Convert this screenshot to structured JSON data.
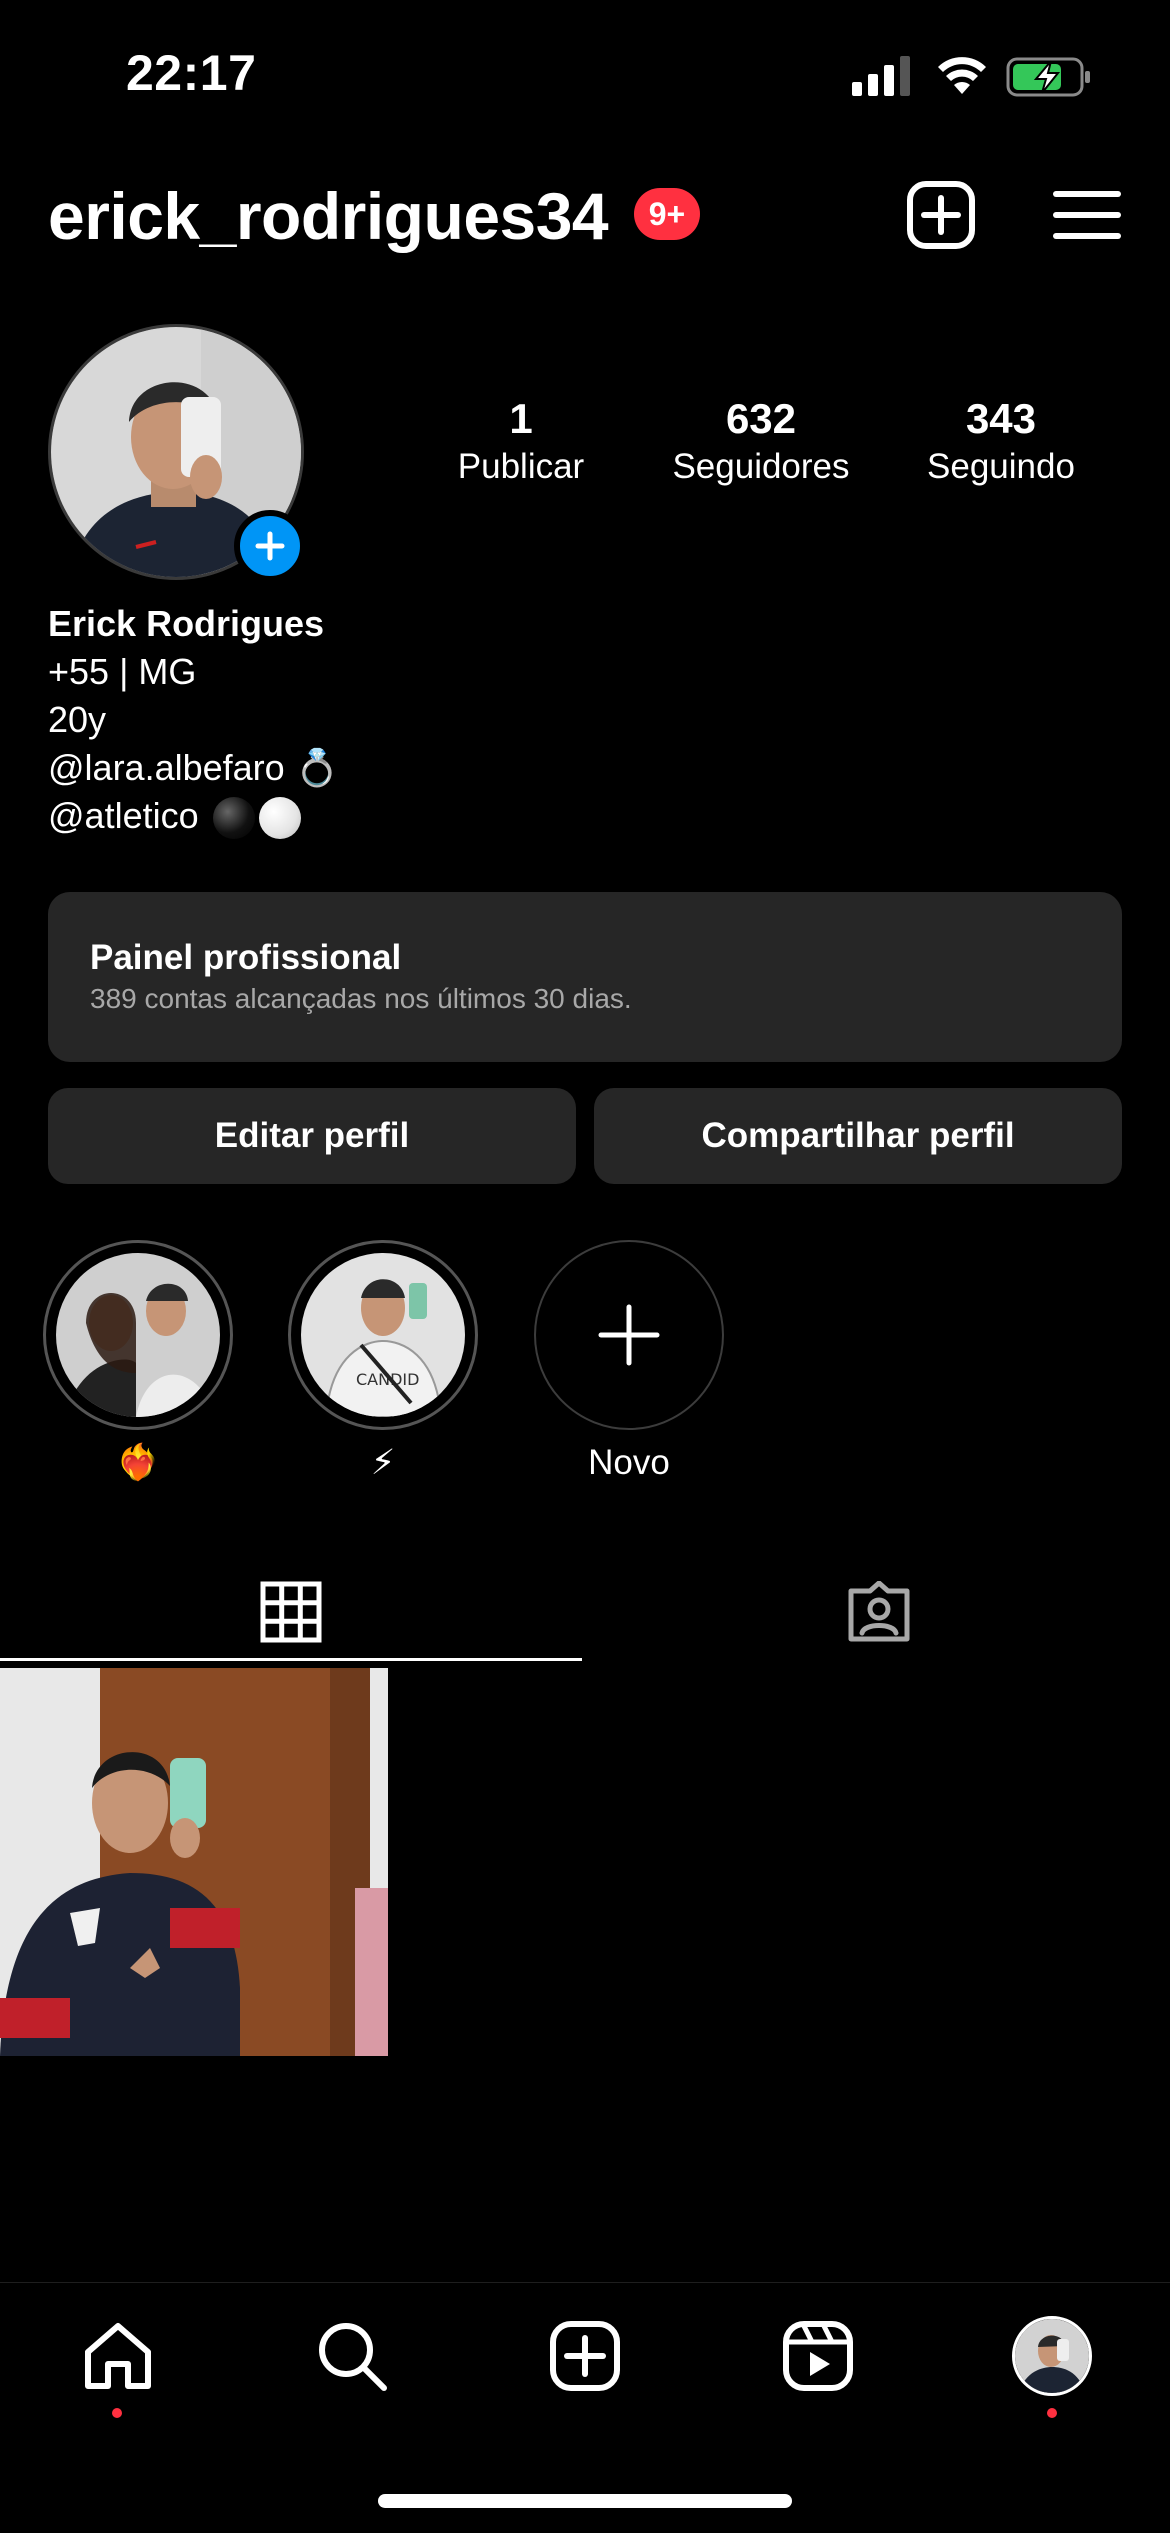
{
  "status_bar": {
    "time": "22:17"
  },
  "header": {
    "username": "erick_rodrigues34",
    "notification_badge": "9+"
  },
  "profile": {
    "stats": [
      {
        "value": "1",
        "label": "Publicar"
      },
      {
        "value": "632",
        "label": "Seguidores"
      },
      {
        "value": "343",
        "label": "Seguindo"
      }
    ],
    "name": "Erick Rodrigues",
    "bio": [
      "+55 | MG",
      "20y",
      "@lara.albefaro 💍",
      "@atletico"
    ]
  },
  "dashboard": {
    "title": "Painel profissional",
    "subtitle": "389 contas alcançadas nos últimos 30 dias."
  },
  "buttons": {
    "edit": "Editar perfil",
    "share": "Compartilhar perfil"
  },
  "highlights": [
    {
      "label": "❤️‍🔥"
    },
    {
      "label": "⚡"
    },
    {
      "label": "Novo"
    }
  ],
  "icons": {
    "header": [
      "create-icon",
      "menu-icon"
    ],
    "tabs": [
      "grid-icon",
      "tagged-icon"
    ],
    "nav": [
      "home-icon",
      "search-icon",
      "create-icon",
      "reels-icon",
      "profile-avatar"
    ]
  },
  "colors": {
    "badge": "#ff3040",
    "accent_blue": "#0095f6",
    "card": "#262626"
  }
}
